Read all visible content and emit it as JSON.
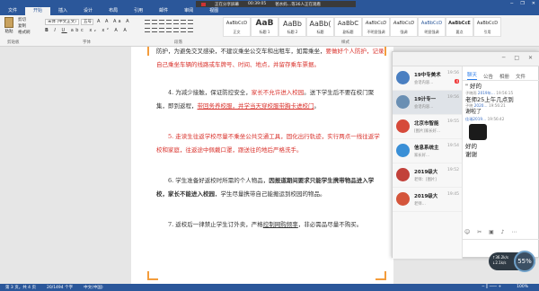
{
  "share_bar": {
    "status": "正在分享屏幕",
    "timer": "00:39:05",
    "viewers": "爸水妈…等36人正在观看"
  },
  "tabs": [
    "文件",
    "开始",
    "插入",
    "设计",
    "布局",
    "引用",
    "邮件",
    "审阅",
    "视图"
  ],
  "ribbon": {
    "paste_label": "粘贴",
    "clip_items": [
      "剪切",
      "复制",
      "格式刷"
    ],
    "font_name": "宋体 (中文正文)",
    "font_size": "五号",
    "groups": [
      "剪贴板",
      "字体",
      "段落",
      "样式"
    ],
    "styles": [
      {
        "sample": "AaBbCcD",
        "name": "正文"
      },
      {
        "sample": "AaB",
        "name": "标题 1"
      },
      {
        "sample": "AaBb",
        "name": "标题 2"
      },
      {
        "sample": "AaBb(",
        "name": "标题"
      },
      {
        "sample": "AaBbC",
        "name": "副标题"
      },
      {
        "sample": "AaBbCcD",
        "name": "不明显强调"
      },
      {
        "sample": "AaBbCcD",
        "name": "强调"
      },
      {
        "sample": "AaBbCcD",
        "name": "明显强调"
      },
      {
        "sample": "AaBbCcE",
        "name": "要点"
      },
      {
        "sample": "AaBbCcD",
        "name": "引用"
      }
    ]
  },
  "doc": {
    "p0_a": "防护，为避免交叉感染，不建议乘坐公交车和出租车，如需乘坐，",
    "p0_red": "要做好个人防护，记录自己乘坐车辆的线路或车牌号、时间、地点，并留存乘车票据。",
    "p4_a": "4. 为减少接触，保证防控安全，",
    "p4_red": "家长不允许进入校园",
    "p4_b": "。送下学生后不要在校门聚集，即到返程，",
    "p4_red2": "带回务养校服，并学当天穿校服带胸卡进校门",
    "p4_c": "。",
    "p5_red": "5. 走读生往返学校尽量不乘坐公共交通工具，固化出行轨迹，实行两点一线往返学校和家庭，往返途中佩戴口罩，跟送往的地后严格洗手。",
    "p6_a": "6. 学生准备好返校时所需的个人物品，",
    "p6_bold": "因报道期间要求只能学生携带物品进入学校，家长不能进入校园",
    "p6_b": "，学生尽量携带自己能搬运到校园的物品。",
    "p7_a": "7. 返校后一律禁止学生订外卖，严格",
    "p7_ul": "控制网购频率",
    "p7_b": "，非必需品尽量不购买。"
  },
  "status": {
    "page": "第 3 页，共 4 页",
    "words": "20/1494 个字",
    "lang": "中文(中国)",
    "zoom_pct": "100%"
  },
  "chat": {
    "contacts": [
      {
        "name": "19中专美术",
        "time": "19:56",
        "preview": "会话内容…",
        "badge": "4"
      },
      {
        "name": "19计专一",
        "time": "19:56",
        "preview": "会话内容…",
        "badge": ""
      },
      {
        "name": "北京市智能",
        "time": "19:55",
        "preview": "[图片]家长好…",
        "badge": ""
      },
      {
        "name": "信息系统主",
        "time": "19:54",
        "preview": "家长好…",
        "badge": ""
      },
      {
        "name": "2019级大",
        "time": "19:52",
        "preview": "老师：[图片]",
        "badge": ""
      },
      {
        "name": "2019级大",
        "time": "19:45",
        "preview": "老师…",
        "badge": ""
      }
    ],
    "convo_tabs": [
      "聊天",
      "公告",
      "相册",
      "文件"
    ],
    "messages": [
      {
        "meta": "",
        "name": "",
        "text": "\" 好的"
      },
      {
        "meta": "子晓雨",
        "name": "2019年…",
        "time": "19:56:15",
        "text": "老师25上午几点到"
      },
      {
        "meta": "子晓",
        "name": "2020…",
        "time": "19:56:21",
        "text": "谢啦了"
      },
      {
        "meta": "",
        "name": "佳瑞2019…",
        "time": "19:56:42",
        "text": ""
      },
      {
        "meta": "",
        "name": "",
        "text": "好的"
      },
      {
        "meta": "",
        "name": "",
        "text": "谢谢"
      }
    ]
  },
  "widget": {
    "up": "↑36.2k/s",
    "down": "↓2.1k/s",
    "pct": "55%"
  }
}
